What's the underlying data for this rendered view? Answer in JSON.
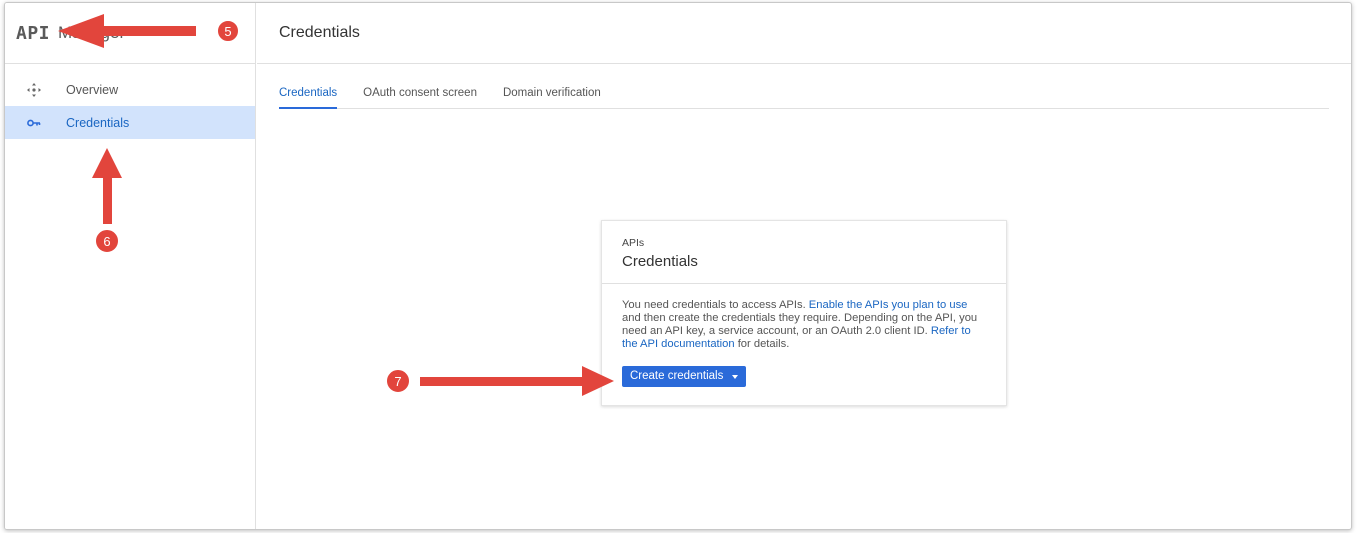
{
  "sidebar": {
    "brand_api": "API",
    "brand_rest": "Manager",
    "items": [
      {
        "label": "Overview",
        "icon": "move-arrows-icon"
      },
      {
        "label": "Credentials",
        "icon": "key-icon"
      }
    ]
  },
  "header": {
    "title": "Credentials"
  },
  "tabs": [
    {
      "label": "Credentials"
    },
    {
      "label": "OAuth consent screen"
    },
    {
      "label": "Domain verification"
    }
  ],
  "card": {
    "kicker": "APIs",
    "title": "Credentials",
    "body_1": "You need credentials to access APIs.",
    "body_link_1": "Enable the APIs you plan to use",
    "body_2": "and then create the credentials they require. Depending on the API, you need an API key, a service account, or an OAuth 2.0 client ID.",
    "body_link_2": "Refer to the API documentation",
    "body_3": "for details.",
    "button_label": "Create credentials"
  },
  "annotations": {
    "badge_5": "5",
    "badge_6": "6",
    "badge_7": "7",
    "arrow_color": "#e2453c"
  },
  "colors": {
    "accent": "#2a6ad9",
    "active_bg": "#d2e3fc",
    "link": "#1a66c2"
  }
}
